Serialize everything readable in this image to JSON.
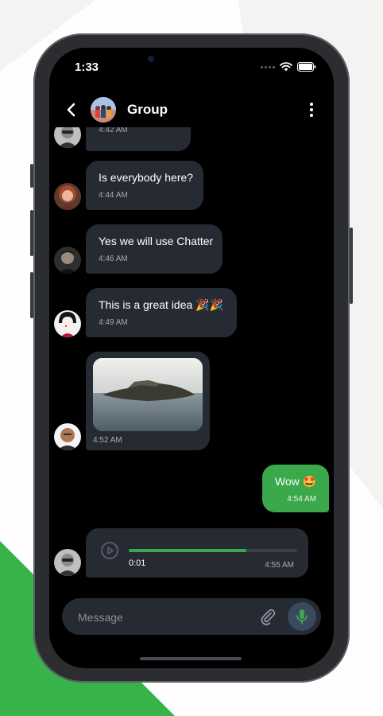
{
  "status_bar": {
    "time": "1:33"
  },
  "header": {
    "title": "Group",
    "back_icon": "chevron-left-icon",
    "menu_icon": "more-vertical-icon"
  },
  "messages": [
    {
      "type": "text",
      "text": "",
      "time": "4:42 AM",
      "avatar": "man-sunglasses-avatar",
      "partial": true
    },
    {
      "type": "text",
      "text": "Is everybody here?",
      "time": "4:44 AM",
      "avatar": "woman-red-hair-avatar"
    },
    {
      "type": "text",
      "text": "Yes we will use Chatter",
      "time": "4:46 AM",
      "avatar": "man-dark-avatar"
    },
    {
      "type": "text",
      "text": "This is a great idea 🎉🎉",
      "time": "4:49 AM",
      "avatar": "woman-geisha-avatar"
    },
    {
      "type": "image",
      "time": "4:52 AM",
      "avatar": "bald-man-avatar",
      "image_subject": "island-photo"
    },
    {
      "type": "text",
      "outgoing": true,
      "text": "Wow 🤩",
      "time": "4:54 AM"
    },
    {
      "type": "voice",
      "elapsed": "0:01",
      "time": "4:55 AM",
      "progress": 0.7,
      "avatar": "man-sunglasses-avatar"
    }
  ],
  "composer": {
    "placeholder": "Message",
    "attach_icon": "paperclip-icon",
    "mic_icon": "microphone-icon"
  },
  "colors": {
    "accent_green": "#3aa84b",
    "bubble_dark": "#262a33",
    "screen_bg": "#000000"
  }
}
